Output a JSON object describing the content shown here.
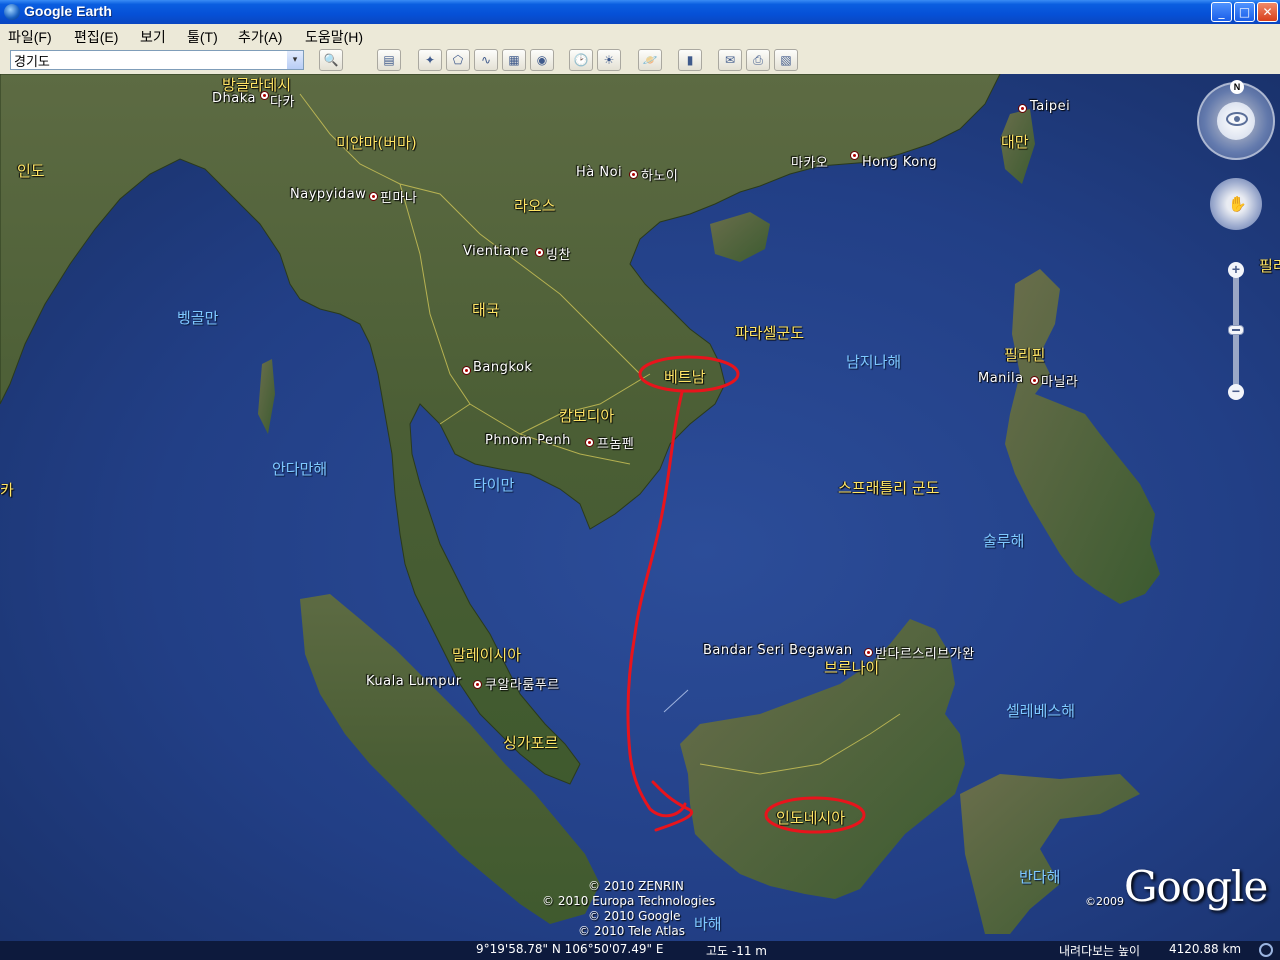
{
  "window": {
    "title": "Google Earth",
    "minimize": "_",
    "maximize": "□",
    "close": "✕"
  },
  "menu": [
    "파일(F)",
    "편집(E)",
    "보기",
    "툴(T)",
    "추가(A)",
    "도움말(H)"
  ],
  "search": {
    "value": "경기도",
    "dropdown_glyph": "▾",
    "search_glyph": "🔍"
  },
  "toolbar_icons": [
    "sidebar-icon",
    "placemark-icon",
    "polygon-icon",
    "path-icon",
    "overlay-icon",
    "tour-icon",
    "historical-imagery-icon",
    "sunlight-icon",
    "planets-icon",
    "ruler-icon",
    "email-icon",
    "print-icon",
    "view-in-maps-icon"
  ],
  "toolbar_glyphs": [
    "▤",
    "✦",
    "⬠",
    "∿",
    "▦",
    "◉",
    "🕑",
    "☀",
    "🪐",
    "▮",
    "✉",
    "⎙",
    "▧"
  ],
  "map_labels": {
    "cities": {
      "dhaka": "Dhaka",
      "dhaka_ko": "다카",
      "naypyidaw": "Naypyidaw",
      "naypyidaw_ko": "핀마나",
      "hanoi": "Hà Noi",
      "hanoi_ko": "하노이",
      "vientiane": "Vientiane",
      "vientiane_ko": "빙찬",
      "hongkong": "Hong Kong",
      "macau_ko": "마카오",
      "taipei": "Taipei",
      "bangkok": "Bangkok",
      "phnompenh": "Phnom Penh",
      "phnompenh_ko": "프놈펜",
      "manila": "Manila",
      "manila_ko": "마닐라",
      "bandar": "Bandar Seri Begawan",
      "bandar_ko": "반다르스리브가완",
      "kl": "Kuala Lumpur",
      "kl_ko": "쿠알라룸푸르"
    },
    "countries": {
      "bangladesh": "방글라데시",
      "myanmar": "미얀마(버마)",
      "india": "인도",
      "laos": "라오스",
      "thailand": "태국",
      "vietnam": "베트남",
      "cambodia": "캄보디아",
      "taiwan": "대만",
      "philippines": "필리핀",
      "brunei": "브루나이",
      "malaysia": "말레이시아",
      "singapore": "싱가포르",
      "indonesia": "인도네시아",
      "philippines_edge": "필리",
      "edge_left": "카"
    },
    "seas": {
      "bengal": "벵골만",
      "andaman": "안다만해",
      "gulf_thailand": "타이만",
      "south_china": "남지나해",
      "paracel": "파라셀군도",
      "spratly": "스프래틀리 군도",
      "sulu": "술루해",
      "celebes": "셀레베스해",
      "banda": "반다해",
      "java_sea": "바해"
    }
  },
  "copyright": [
    "© 2010 ZENRIN",
    "© 2010 Europa Technologies",
    "© 2010 Google",
    "© 2010 Tele Atlas"
  ],
  "logo": {
    "text": "Google",
    "year": "©2009"
  },
  "status": {
    "coords": "9°19'58.78\" N  106°50'07.49\" E",
    "altitude": "고도  -11 m",
    "eye_alt_label": "내려다보는 높이",
    "eye_alt_value": "4120.88 km"
  },
  "nav": {
    "north": "N",
    "zoom_in": "+",
    "zoom_out": "−",
    "hand": "✋"
  },
  "annotation_color": "#e8141c"
}
